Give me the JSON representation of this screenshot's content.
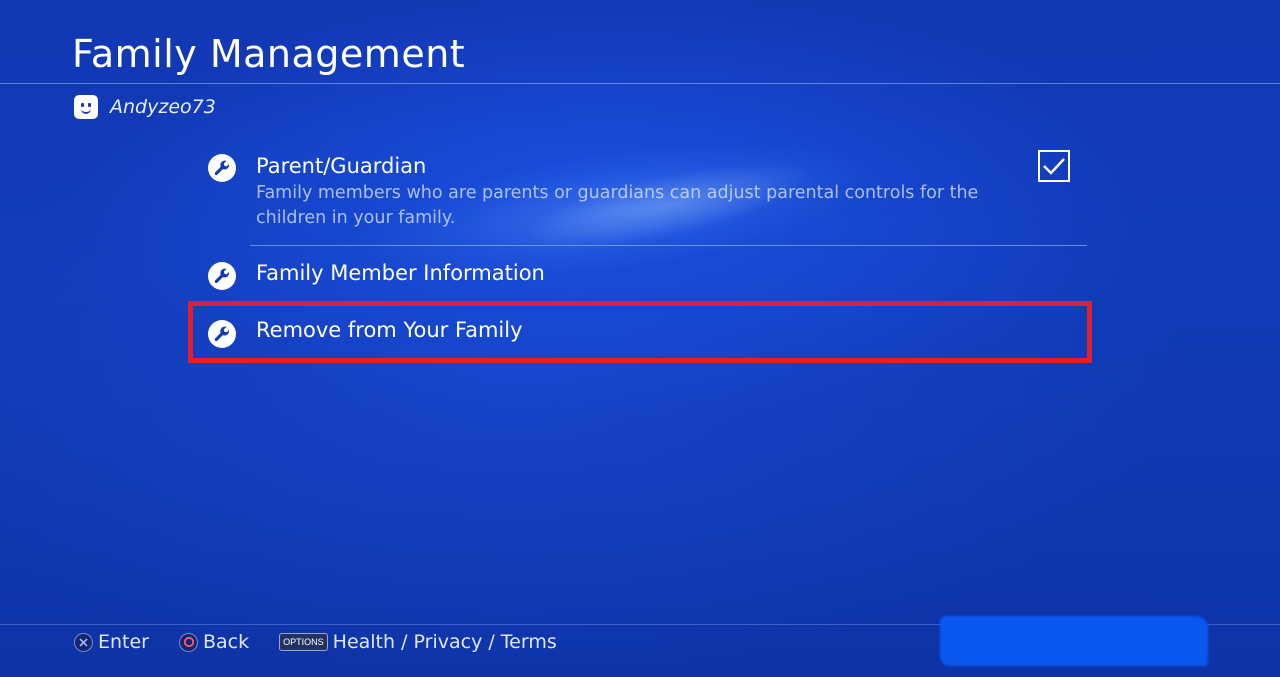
{
  "header": {
    "title": "Family Management",
    "username": "Andyzeo73"
  },
  "menu": {
    "items": [
      {
        "label": "Parent/Guardian",
        "description": "Family members who are parents or guardians can adjust parental controls for the children in your family.",
        "checked": true,
        "icon": "wrench-icon"
      },
      {
        "label": "Family Member Information",
        "icon": "wrench-icon"
      },
      {
        "label": "Remove from Your Family",
        "icon": "wrench-icon",
        "highlighted": true
      }
    ]
  },
  "footer": {
    "enter_label": "Enter",
    "back_label": "Back",
    "options_badge": "OPTIONS",
    "options_label": "Health / Privacy / Terms"
  },
  "colors": {
    "background": "#1238b4",
    "highlight_border": "#e0202e",
    "text": "#ffffff"
  }
}
